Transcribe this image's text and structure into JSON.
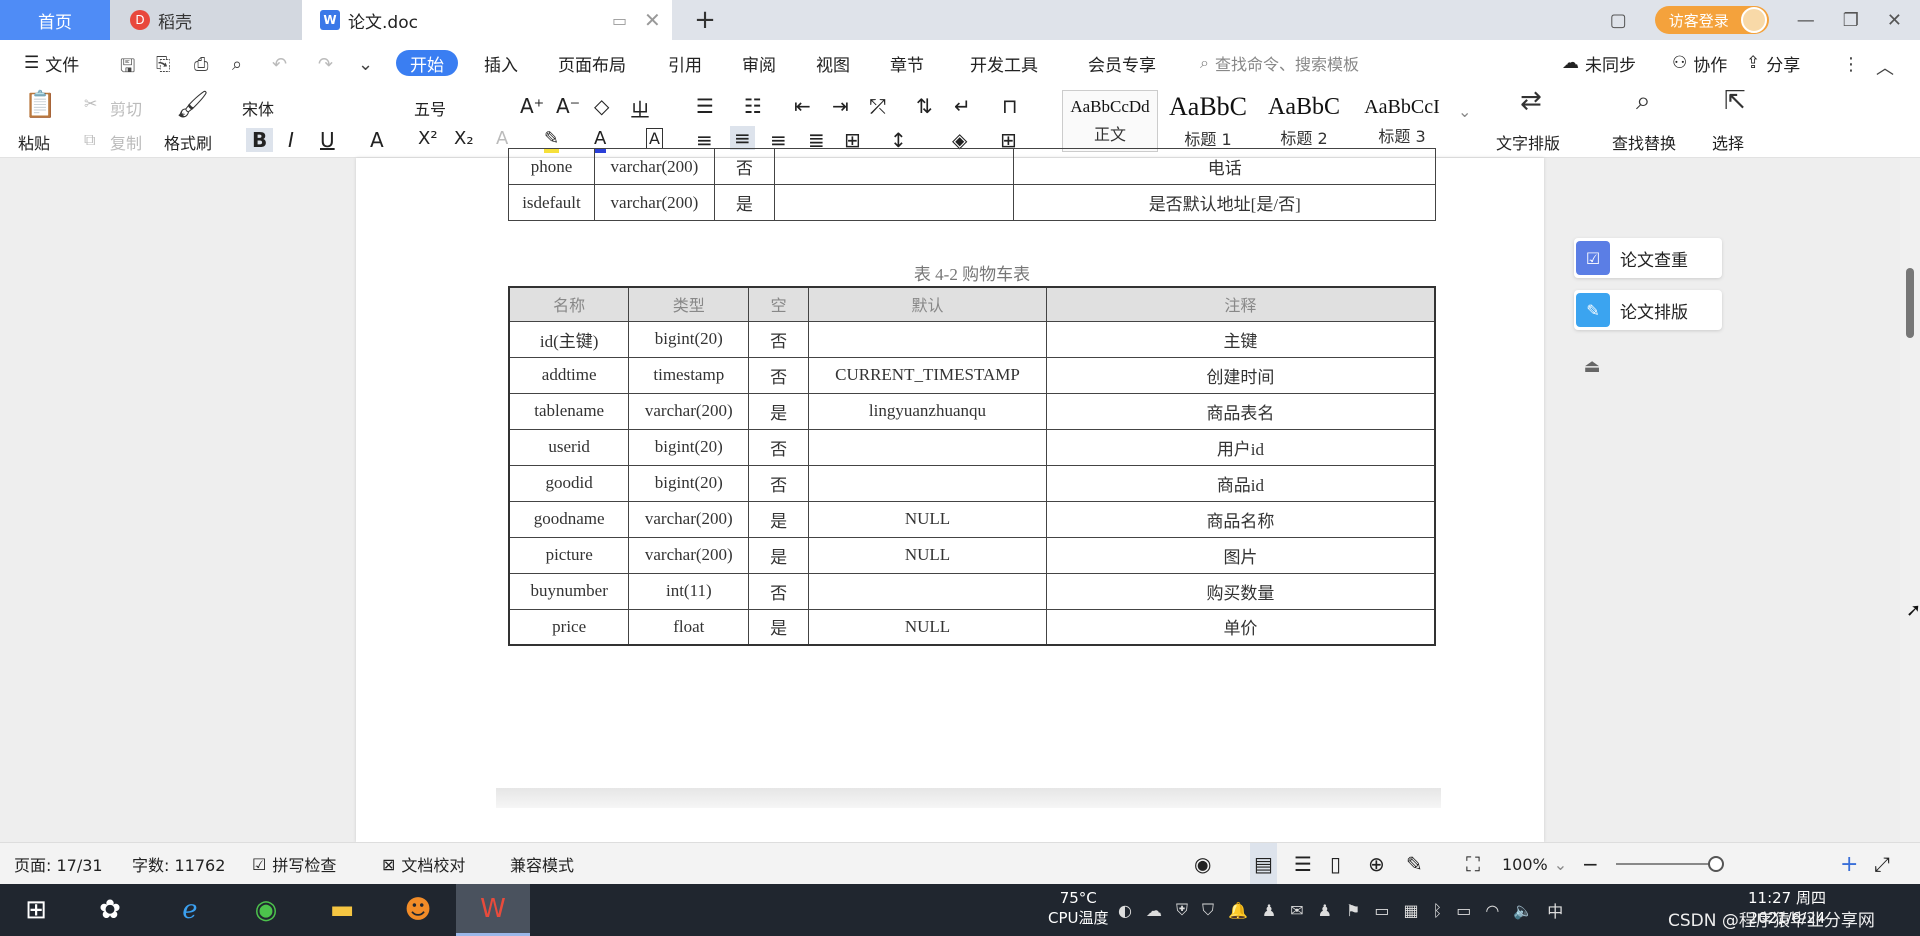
{
  "tabs": {
    "home": "首页",
    "docer": "稻壳",
    "document": "论文.doc",
    "login": "访客登录"
  },
  "menu": {
    "file": "文件",
    "start": "开始",
    "insert": "插入",
    "layout": "页面布局",
    "reference": "引用",
    "review": "审阅",
    "view": "视图",
    "section": "章节",
    "dev": "开发工具",
    "member": "会员专享",
    "search_placeholder": "查找命令、搜索模板",
    "sync": "未同步",
    "collab": "协作",
    "share": "分享"
  },
  "ribbon": {
    "paste": "粘贴",
    "cut": "剪切",
    "copy": "复制",
    "format_painter": "格式刷",
    "font_name": "宋体",
    "font_size": "五号",
    "styles": [
      {
        "sample": "AaBbCcDd",
        "name": "正文"
      },
      {
        "sample": "AaBbC",
        "name": "标题 1"
      },
      {
        "sample": "AaBbC",
        "name": "标题 2"
      },
      {
        "sample": "AaBbCcI",
        "name": "标题 3"
      }
    ],
    "text_layout": "文字排版",
    "find_replace": "查找替换",
    "select": "选择"
  },
  "doc": {
    "prev_rows": [
      [
        "phone",
        "varchar(200)",
        "否",
        "",
        "电话"
      ],
      [
        "isdefault",
        "varchar(200)",
        "是",
        "",
        "是否默认地址[是/否]"
      ]
    ],
    "caption": "表 4-2 购物车表",
    "headers": [
      "名称",
      "类型",
      "空",
      "默认",
      "注释"
    ],
    "rows": [
      [
        "id(主键)",
        "bigint(20)",
        "否",
        "",
        "主键"
      ],
      [
        "addtime",
        "timestamp",
        "否",
        "CURRENT_TIMESTAMP",
        "创建时间"
      ],
      [
        "tablename",
        "varchar(200)",
        "是",
        "lingyuanzhuanqu",
        "商品表名"
      ],
      [
        "userid",
        "bigint(20)",
        "否",
        "",
        "用户id"
      ],
      [
        "goodid",
        "bigint(20)",
        "否",
        "",
        "商品id"
      ],
      [
        "goodname",
        "varchar(200)",
        "是",
        "NULL",
        "商品名称"
      ],
      [
        "picture",
        "varchar(200)",
        "是",
        "NULL",
        "图片"
      ],
      [
        "buynumber",
        "int(11)",
        "否",
        "",
        "购买数量"
      ],
      [
        "price",
        "float",
        "是",
        "NULL",
        "单价"
      ]
    ]
  },
  "side_panel": {
    "check": "论文查重",
    "format": "论文排版"
  },
  "status": {
    "page": "页面: 17/31",
    "words": "字数: 11762",
    "spell": "拼写检查",
    "proof": "文档校对",
    "compat": "兼容模式",
    "zoom": "100%"
  },
  "taskbar": {
    "temp": "75°C",
    "cpu": "CPU温度",
    "time": "11:27 周四",
    "date": "2021/6/24",
    "ime": "中",
    "watermark": "CSDN @程序猿毕业分享网"
  }
}
